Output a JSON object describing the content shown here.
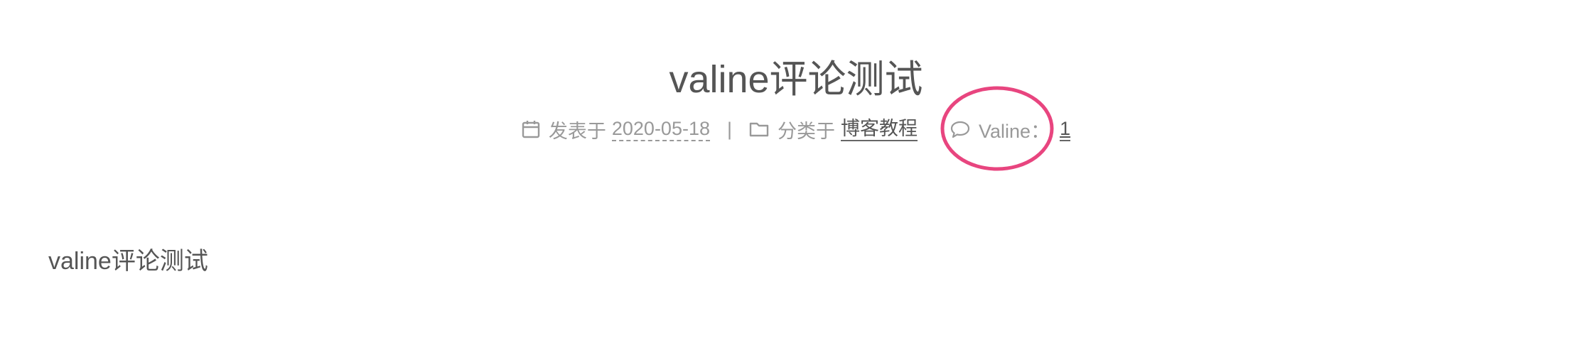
{
  "post": {
    "title": "valine评论测试",
    "meta": {
      "posted_label": "发表于",
      "date": "2020-05-18",
      "divider": "|",
      "category_label": "分类于",
      "category": "博客教程",
      "comments_label": "Valine：",
      "comments_count": "1"
    },
    "body": "valine评论测试"
  },
  "icons": {
    "calendar": "calendar-icon",
    "folder": "folder-icon",
    "comment": "comment-icon"
  },
  "colors": {
    "text": "#555555",
    "meta_text": "#999999",
    "highlight": "#e8457f"
  }
}
